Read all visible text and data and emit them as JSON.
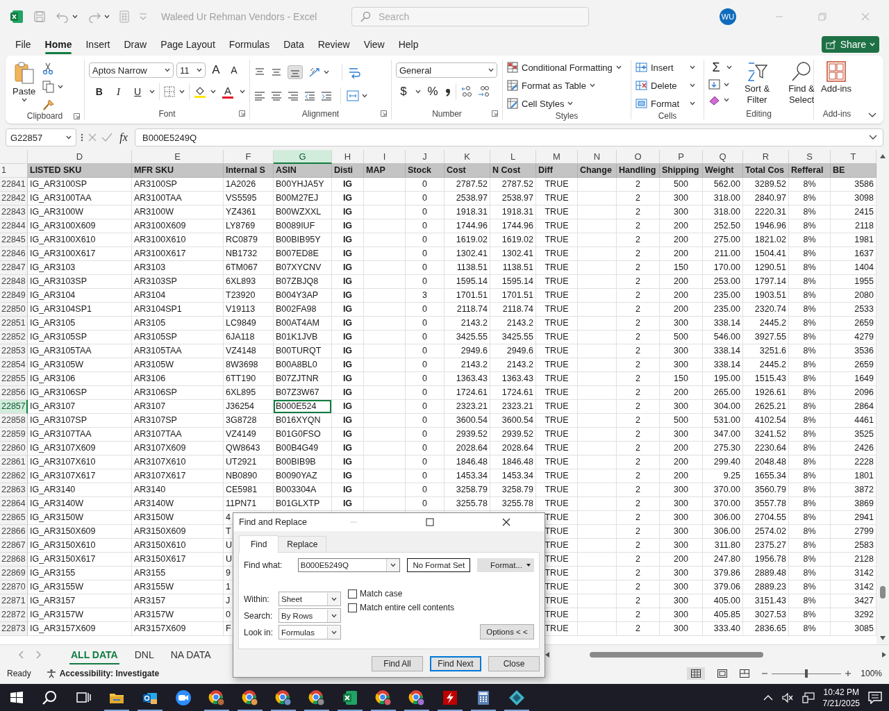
{
  "title_bar": {
    "document_title": "Waleed Ur Rehman Vendors  -  Excel",
    "search_placeholder": "Search",
    "avatar": "WU"
  },
  "menu_tabs": [
    {
      "label": "File",
      "selected": false
    },
    {
      "label": "Home",
      "selected": true
    },
    {
      "label": "Insert",
      "selected": false
    },
    {
      "label": "Draw",
      "selected": false
    },
    {
      "label": "Page Layout",
      "selected": false
    },
    {
      "label": "Formulas",
      "selected": false
    },
    {
      "label": "Data",
      "selected": false
    },
    {
      "label": "Review",
      "selected": false
    },
    {
      "label": "View",
      "selected": false
    },
    {
      "label": "Help",
      "selected": false
    }
  ],
  "share_button": "Share",
  "ribbon": {
    "clipboard": {
      "label": "Clipboard",
      "paste": "Paste"
    },
    "font": {
      "label": "Font",
      "family": "Aptos Narrow",
      "size": "11",
      "grow": "A",
      "shrink": "A",
      "bold": "B",
      "italic": "I",
      "underline": "U",
      "font_color": "A"
    },
    "alignment": {
      "label": "Alignment"
    },
    "number": {
      "label": "Number",
      "format": "General",
      "currency": "$",
      "percent": "%"
    },
    "styles": {
      "label": "Styles",
      "items": [
        "Conditional Formatting",
        "Format as Table",
        "Cell Styles"
      ]
    },
    "cells": {
      "label": "Cells",
      "items": [
        "Insert",
        "Delete",
        "Format"
      ]
    },
    "editing": {
      "label": "Editing",
      "autosum": "Σ",
      "sort": "Sort & Filter",
      "find": "Find & Select"
    },
    "addins": {
      "label": "Add-ins",
      "button": "Add-ins"
    }
  },
  "formula_bar": {
    "name_box": "G22857",
    "function_label": "fx",
    "formula": "B000E5249Q"
  },
  "columns": [
    {
      "letter": "D",
      "selected": false
    },
    {
      "letter": "E",
      "selected": false
    },
    {
      "letter": "F",
      "selected": false
    },
    {
      "letter": "G",
      "selected": true
    },
    {
      "letter": "H",
      "selected": false
    },
    {
      "letter": "I",
      "selected": false
    },
    {
      "letter": "J",
      "selected": false
    },
    {
      "letter": "K",
      "selected": false
    },
    {
      "letter": "L",
      "selected": false
    },
    {
      "letter": "M",
      "selected": false
    },
    {
      "letter": "N",
      "selected": false
    },
    {
      "letter": "O",
      "selected": false
    },
    {
      "letter": "P",
      "selected": false
    },
    {
      "letter": "Q",
      "selected": false
    },
    {
      "letter": "R",
      "selected": false
    },
    {
      "letter": "S",
      "selected": false
    },
    {
      "letter": "T",
      "selected": false
    }
  ],
  "rows": [
    {
      "number": "1",
      "kind": "header",
      "selected": false,
      "cells": {
        "D": "LISTED SKU",
        "E": "MFR SKU",
        "F": "Internal S",
        "G": "ASIN",
        "H": "Disti",
        "I": "MAP",
        "J": "Stock",
        "K": "Cost",
        "L": "N Cost",
        "M": "Diff",
        "N": "Change",
        "O": "Handling",
        "P": "Shipping",
        "Q": "Weight",
        "R": "Total Cos",
        "S": "Refferal",
        "T": "BE"
      }
    },
    {
      "number": "22841",
      "kind": "data",
      "selected": false,
      "cells": {
        "D": "IG_AR3100SP",
        "E": "AR3100SP",
        "F": "1A2026",
        "G": "B00YHJA5Y",
        "H": "IG",
        "J": "0",
        "K": "2787.52",
        "L": "2787.52",
        "M": "TRUE",
        "O": "2",
        "P": "500",
        "Q": "562.00",
        "R": "3289.52",
        "S": "8%",
        "T": "3586"
      }
    },
    {
      "number": "22842",
      "kind": "data",
      "selected": false,
      "cells": {
        "D": "IG_AR3100TAA",
        "E": "AR3100TAA",
        "F": "VS5595",
        "G": "B00M27EJ",
        "H": "IG",
        "J": "0",
        "K": "2538.97",
        "L": "2538.97",
        "M": "TRUE",
        "O": "2",
        "P": "300",
        "Q": "318.00",
        "R": "2840.97",
        "S": "8%",
        "T": "3098"
      }
    },
    {
      "number": "22843",
      "kind": "data",
      "selected": false,
      "cells": {
        "D": "IG_AR3100W",
        "E": "AR3100W",
        "F": "YZ4361",
        "G": "B00WZXXL",
        "H": "IG",
        "J": "0",
        "K": "1918.31",
        "L": "1918.31",
        "M": "TRUE",
        "O": "2",
        "P": "300",
        "Q": "318.00",
        "R": "2220.31",
        "S": "8%",
        "T": "2415"
      }
    },
    {
      "number": "22844",
      "kind": "data",
      "selected": false,
      "cells": {
        "D": "IG_AR3100X609",
        "E": "AR3100X609",
        "F": "LY8769",
        "G": "B0089IUF",
        "H": "IG",
        "J": "0",
        "K": "1744.96",
        "L": "1744.96",
        "M": "TRUE",
        "O": "2",
        "P": "200",
        "Q": "252.50",
        "R": "1946.96",
        "S": "8%",
        "T": "2118"
      }
    },
    {
      "number": "22845",
      "kind": "data",
      "selected": false,
      "cells": {
        "D": "IG_AR3100X610",
        "E": "AR3100X610",
        "F": "RC0879",
        "G": "B00BIB95Y",
        "H": "IG",
        "J": "0",
        "K": "1619.02",
        "L": "1619.02",
        "M": "TRUE",
        "O": "2",
        "P": "200",
        "Q": "275.00",
        "R": "1821.02",
        "S": "8%",
        "T": "1981"
      }
    },
    {
      "number": "22846",
      "kind": "data",
      "selected": false,
      "cells": {
        "D": "IG_AR3100X617",
        "E": "AR3100X617",
        "F": "NB1732",
        "G": "B007ED8E",
        "H": "IG",
        "J": "0",
        "K": "1302.41",
        "L": "1302.41",
        "M": "TRUE",
        "O": "2",
        "P": "200",
        "Q": "211.00",
        "R": "1504.41",
        "S": "8%",
        "T": "1637"
      }
    },
    {
      "number": "22847",
      "kind": "data",
      "selected": false,
      "cells": {
        "D": "IG_AR3103",
        "E": "AR3103",
        "F": "6TM067",
        "G": "B07XYCNV",
        "H": "IG",
        "J": "0",
        "K": "1138.51",
        "L": "1138.51",
        "M": "TRUE",
        "O": "2",
        "P": "150",
        "Q": "170.00",
        "R": "1290.51",
        "S": "8%",
        "T": "1404"
      }
    },
    {
      "number": "22848",
      "kind": "data",
      "selected": false,
      "cells": {
        "D": "IG_AR3103SP",
        "E": "AR3103SP",
        "F": "6XL893",
        "G": "B07ZBJQ8",
        "H": "IG",
        "J": "0",
        "K": "1595.14",
        "L": "1595.14",
        "M": "TRUE",
        "O": "2",
        "P": "200",
        "Q": "253.00",
        "R": "1797.14",
        "S": "8%",
        "T": "1955"
      }
    },
    {
      "number": "22849",
      "kind": "data",
      "selected": false,
      "cells": {
        "D": "IG_AR3104",
        "E": "AR3104",
        "F": "T23920",
        "G": "B004Y3AP",
        "H": "IG",
        "J": "3",
        "K": "1701.51",
        "L": "1701.51",
        "M": "TRUE",
        "O": "2",
        "P": "200",
        "Q": "235.00",
        "R": "1903.51",
        "S": "8%",
        "T": "2080"
      }
    },
    {
      "number": "22850",
      "kind": "data",
      "selected": false,
      "cells": {
        "D": "IG_AR3104SP1",
        "E": "AR3104SP1",
        "F": "V19113",
        "G": "B002FA98",
        "H": "IG",
        "J": "0",
        "K": "2118.74",
        "L": "2118.74",
        "M": "TRUE",
        "O": "2",
        "P": "200",
        "Q": "235.00",
        "R": "2320.74",
        "S": "8%",
        "T": "2533"
      }
    },
    {
      "number": "22851",
      "kind": "data",
      "selected": false,
      "cells": {
        "D": "IG_AR3105",
        "E": "AR3105",
        "F": "LC9849",
        "G": "B00AT4AM",
        "H": "IG",
        "J": "0",
        "K": "2143.2",
        "L": "2143.2",
        "M": "TRUE",
        "O": "2",
        "P": "300",
        "Q": "338.14",
        "R": "2445.2",
        "S": "8%",
        "T": "2659"
      }
    },
    {
      "number": "22852",
      "kind": "data",
      "selected": false,
      "cells": {
        "D": "IG_AR3105SP",
        "E": "AR3105SP",
        "F": "6JA118",
        "G": "B01K1JVB",
        "H": "IG",
        "J": "0",
        "K": "3425.55",
        "L": "3425.55",
        "M": "TRUE",
        "O": "2",
        "P": "500",
        "Q": "546.00",
        "R": "3927.55",
        "S": "8%",
        "T": "4279"
      }
    },
    {
      "number": "22853",
      "kind": "data",
      "selected": false,
      "cells": {
        "D": "IG_AR3105TAA",
        "E": "AR3105TAA",
        "F": "VZ4148",
        "G": "B00TURQT",
        "H": "IG",
        "J": "0",
        "K": "2949.6",
        "L": "2949.6",
        "M": "TRUE",
        "O": "2",
        "P": "300",
        "Q": "338.14",
        "R": "3251.6",
        "S": "8%",
        "T": "3536"
      }
    },
    {
      "number": "22854",
      "kind": "data",
      "selected": false,
      "cells": {
        "D": "IG_AR3105W",
        "E": "AR3105W",
        "F": "8W3698",
        "G": "B00A8BL0",
        "H": "IG",
        "J": "0",
        "K": "2143.2",
        "L": "2143.2",
        "M": "TRUE",
        "O": "2",
        "P": "300",
        "Q": "338.14",
        "R": "2445.2",
        "S": "8%",
        "T": "2659"
      }
    },
    {
      "number": "22855",
      "kind": "data",
      "selected": false,
      "cells": {
        "D": "IG_AR3106",
        "E": "AR3106",
        "F": "6TT190",
        "G": "B07ZJTNR",
        "H": "IG",
        "J": "0",
        "K": "1363.43",
        "L": "1363.43",
        "M": "TRUE",
        "O": "2",
        "P": "150",
        "Q": "195.00",
        "R": "1515.43",
        "S": "8%",
        "T": "1649"
      }
    },
    {
      "number": "22856",
      "kind": "data",
      "selected": false,
      "cells": {
        "D": "IG_AR3106SP",
        "E": "AR3106SP",
        "F": "6XL895",
        "G": "B07Z3W67",
        "H": "IG",
        "J": "0",
        "K": "1724.61",
        "L": "1724.61",
        "M": "TRUE",
        "O": "2",
        "P": "200",
        "Q": "265.00",
        "R": "1926.61",
        "S": "8%",
        "T": "2096"
      }
    },
    {
      "number": "22857",
      "kind": "data",
      "selected": true,
      "cells": {
        "D": "IG_AR3107",
        "E": "AR3107",
        "F": "J36254",
        "G": "B000E524",
        "H": "IG",
        "J": "0",
        "K": "2323.21",
        "L": "2323.21",
        "M": "TRUE",
        "O": "2",
        "P": "300",
        "Q": "304.00",
        "R": "2625.21",
        "S": "8%",
        "T": "2864"
      }
    },
    {
      "number": "22858",
      "kind": "data",
      "selected": false,
      "cells": {
        "D": "IG_AR3107SP",
        "E": "AR3107SP",
        "F": "3G8728",
        "G": "B016XYQN",
        "H": "IG",
        "J": "0",
        "K": "3600.54",
        "L": "3600.54",
        "M": "TRUE",
        "O": "2",
        "P": "500",
        "Q": "531.00",
        "R": "4102.54",
        "S": "8%",
        "T": "4461"
      }
    },
    {
      "number": "22859",
      "kind": "data",
      "selected": false,
      "cells": {
        "D": "IG_AR3107TAA",
        "E": "AR3107TAA",
        "F": "VZ4149",
        "G": "B01G0FSO",
        "H": "IG",
        "J": "0",
        "K": "2939.52",
        "L": "2939.52",
        "M": "TRUE",
        "O": "2",
        "P": "300",
        "Q": "347.00",
        "R": "3241.52",
        "S": "8%",
        "T": "3525"
      }
    },
    {
      "number": "22860",
      "kind": "data",
      "selected": false,
      "cells": {
        "D": "IG_AR3107X609",
        "E": "AR3107X609",
        "F": "QW8643",
        "G": "B00B4G49",
        "H": "IG",
        "J": "0",
        "K": "2028.64",
        "L": "2028.64",
        "M": "TRUE",
        "O": "2",
        "P": "200",
        "Q": "275.30",
        "R": "2230.64",
        "S": "8%",
        "T": "2426"
      }
    },
    {
      "number": "22861",
      "kind": "data",
      "selected": false,
      "cells": {
        "D": "IG_AR3107X610",
        "E": "AR3107X610",
        "F": "UT2921",
        "G": "B00BIB9B",
        "H": "IG",
        "J": "0",
        "K": "1846.48",
        "L": "1846.48",
        "M": "TRUE",
        "O": "2",
        "P": "200",
        "Q": "299.40",
        "R": "2048.48",
        "S": "8%",
        "T": "2228"
      }
    },
    {
      "number": "22862",
      "kind": "data",
      "selected": false,
      "cells": {
        "D": "IG_AR3107X617",
        "E": "AR3107X617",
        "F": "NB0890",
        "G": "B0090YAZ",
        "H": "IG",
        "J": "0",
        "K": "1453.34",
        "L": "1453.34",
        "M": "TRUE",
        "O": "2",
        "P": "200",
        "Q": "9.25",
        "R": "1655.34",
        "S": "8%",
        "T": "1801"
      }
    },
    {
      "number": "22863",
      "kind": "data",
      "selected": false,
      "cells": {
        "D": "IG_AR3140",
        "E": "AR3140",
        "F": "CE5981",
        "G": "B003304A",
        "H": "IG",
        "J": "0",
        "K": "3258.79",
        "L": "3258.79",
        "M": "TRUE",
        "O": "2",
        "P": "300",
        "Q": "370.00",
        "R": "3560.79",
        "S": "8%",
        "T": "3872"
      }
    },
    {
      "number": "22864",
      "kind": "data",
      "selected": false,
      "cells": {
        "D": "IG_AR3140W",
        "E": "AR3140W",
        "F": "11PN71",
        "G": "B01GLXTP",
        "H": "IG",
        "J": "0",
        "K": "3255.78",
        "L": "3255.78",
        "M": "TRUE",
        "O": "2",
        "P": "300",
        "Q": "370.00",
        "R": "3557.78",
        "S": "8%",
        "T": "3869"
      }
    },
    {
      "number": "22865",
      "kind": "data",
      "selected": false,
      "cells": {
        "D": "IG_AR3150W",
        "E": "AR3150W",
        "F": "4",
        "M": "TRUE",
        "O": "2",
        "P": "300",
        "Q": "306.00",
        "R": "2704.55",
        "S": "8%",
        "T": "2941"
      }
    },
    {
      "number": "22866",
      "kind": "data",
      "selected": false,
      "cells": {
        "D": "IG_AR3150X609",
        "E": "AR3150X609",
        "F": "T",
        "M": "TRUE",
        "O": "2",
        "P": "300",
        "Q": "306.00",
        "R": "2574.02",
        "S": "8%",
        "T": "2799"
      }
    },
    {
      "number": "22867",
      "kind": "data",
      "selected": false,
      "cells": {
        "D": "IG_AR3150X610",
        "E": "AR3150X610",
        "F": "U",
        "M": "TRUE",
        "O": "2",
        "P": "300",
        "Q": "311.80",
        "R": "2375.27",
        "S": "8%",
        "T": "2583"
      }
    },
    {
      "number": "22868",
      "kind": "data",
      "selected": false,
      "cells": {
        "D": "IG_AR3150X617",
        "E": "AR3150X617",
        "F": "U",
        "M": "TRUE",
        "O": "2",
        "P": "200",
        "Q": "247.80",
        "R": "1956.78",
        "S": "8%",
        "T": "2128"
      }
    },
    {
      "number": "22869",
      "kind": "data",
      "selected": false,
      "cells": {
        "D": "IG_AR3155",
        "E": "AR3155",
        "F": "9",
        "M": "TRUE",
        "O": "2",
        "P": "300",
        "Q": "379.86",
        "R": "2889.48",
        "S": "8%",
        "T": "3142"
      }
    },
    {
      "number": "22870",
      "kind": "data",
      "selected": false,
      "cells": {
        "D": "IG_AR3155W",
        "E": "AR3155W",
        "F": "1",
        "M": "TRUE",
        "O": "2",
        "P": "300",
        "Q": "379.06",
        "R": "2889.23",
        "S": "8%",
        "T": "3142"
      }
    },
    {
      "number": "22871",
      "kind": "data",
      "selected": false,
      "cells": {
        "D": "IG_AR3157",
        "E": "AR3157",
        "F": "J",
        "M": "TRUE",
        "O": "2",
        "P": "300",
        "Q": "405.00",
        "R": "3151.43",
        "S": "8%",
        "T": "3427"
      }
    },
    {
      "number": "22872",
      "kind": "data",
      "selected": false,
      "cells": {
        "D": "IG_AR3157W",
        "E": "AR3157W",
        "F": "0",
        "M": "TRUE",
        "O": "2",
        "P": "300",
        "Q": "405.85",
        "R": "3027.53",
        "S": "8%",
        "T": "3292"
      }
    },
    {
      "number": "22873",
      "kind": "data",
      "selected": false,
      "cells": {
        "D": "IG_AR3157X609",
        "E": "AR3157X609",
        "F": "F",
        "M": "TRUE",
        "O": "2",
        "P": "300",
        "Q": "333.40",
        "R": "2836.65",
        "S": "8%",
        "T": "3085"
      }
    }
  ],
  "sheet_tabs": [
    {
      "label": "ALL DATA",
      "selected": true
    },
    {
      "label": "DNL",
      "selected": false
    },
    {
      "label": "NA DATA",
      "selected": false
    }
  ],
  "status_bar": {
    "status": "Ready",
    "accessibility": "Accessibility: Investigate",
    "zoom": "100%",
    "zoom_slider": {
      "level": 0.5
    }
  },
  "dialog": {
    "title": "Find and Replace",
    "tabs": [
      {
        "label": "Find",
        "selected": true
      },
      {
        "label": "Replace",
        "selected": false
      }
    ],
    "find_what_label": "Find what:",
    "find_what": "B000E5249Q",
    "format_status": "No Format Set",
    "format_button": "Format...",
    "options": [
      {
        "label": "Within:",
        "value": "Sheet"
      },
      {
        "label": "Search:",
        "value": "By Rows"
      },
      {
        "label": "Look in:",
        "value": "Formulas"
      }
    ],
    "checkboxes": [
      {
        "label": "Match case",
        "checked": false
      },
      {
        "label": "Match entire cell contents",
        "checked": false
      }
    ],
    "options_button": "Options < <",
    "buttons": [
      {
        "label": "Find All",
        "default": false
      },
      {
        "label": "Find Next",
        "default": true
      },
      {
        "label": "Close",
        "default": false
      }
    ]
  },
  "taskbar": {
    "time": "10:42 PM",
    "date": "7/21/2025"
  }
}
